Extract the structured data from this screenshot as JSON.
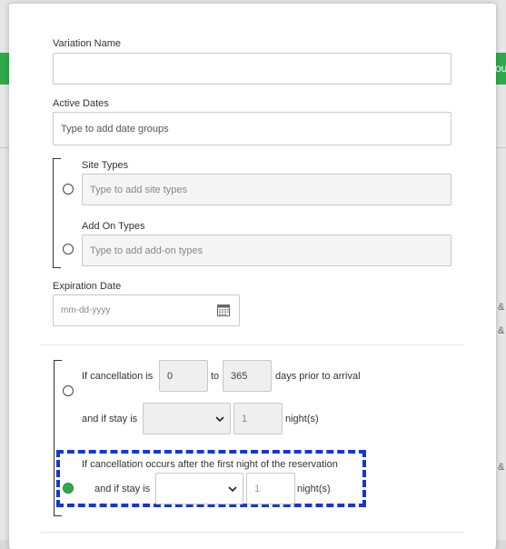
{
  "background": {
    "right_partial": "ou",
    "side_marks": [
      "&",
      "&",
      "&"
    ]
  },
  "form": {
    "variation_name": {
      "label": "Variation Name",
      "value": ""
    },
    "active_dates": {
      "label": "Active Dates",
      "placeholder": "Type to add date groups"
    },
    "site_types": {
      "label": "Site Types",
      "placeholder": "Type to add site types"
    },
    "add_on_types": {
      "label": "Add On Types",
      "placeholder": "Type to add add-on types"
    },
    "expiration_date": {
      "label": "Expiration Date",
      "placeholder": "mm-dd-yyyy"
    },
    "rule1": {
      "prefix": "If cancellation is",
      "from": "0",
      "to_word": "to",
      "to": "365",
      "suffix": "days prior to arrival",
      "stay_prefix": "and if stay is",
      "stay_select": "",
      "nights": "1",
      "nights_suffix": "night(s)"
    },
    "rule2": {
      "title": "If cancellation occurs after the first night of the reservation",
      "stay_prefix": "and if stay is",
      "stay_select": "",
      "nights": "1",
      "nights_suffix": "night(s)",
      "selected": true
    }
  },
  "colors": {
    "accent_green": "#2eaa4a",
    "highlight_blue": "#1436d9"
  }
}
